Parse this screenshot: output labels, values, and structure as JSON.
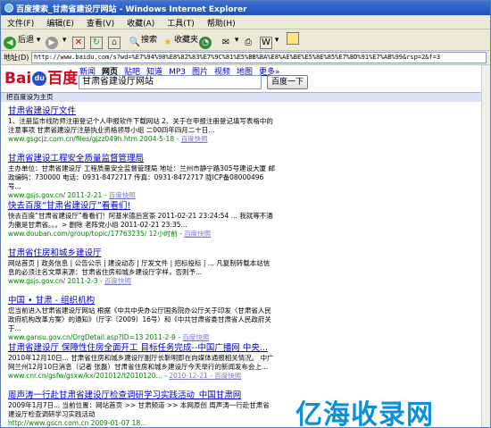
{
  "window": {
    "title": "百度搜索_甘肃省建设厅网站 - Windows Internet Explorer"
  },
  "menu": [
    "文件(F)",
    "编辑(E)",
    "查看(V)",
    "收藏(A)",
    "工具(T)",
    "帮助(H)"
  ],
  "toolbar": {
    "back": "后退",
    "search": "搜索",
    "favorites": "收藏夹"
  },
  "address": {
    "label": "地址(D)",
    "url": "http://www.baidu.com/s?wd=%E7%94%98%E8%82%83%E7%9C%81%E5%BB%BA%E8%AE%BE%E5%8E%85%E7%BD%91%E7%AB%99&rsp=2&f=3"
  },
  "baidu": {
    "logo_left": "Bai",
    "logo_paw": "du",
    "logo_right": "百度",
    "nav": [
      "新闻",
      "网页",
      "贴吧",
      "知道",
      "MP3",
      "图片",
      "视频",
      "地图",
      "更多»"
    ],
    "nav_active": "网页",
    "query": "甘肃省建设厅网站",
    "search_button": "百度一下",
    "set_home": "把百度设为主页"
  },
  "results": [
    {
      "title": "甘肃省建设厅文件",
      "desc": "1、注册监市线防师注册登记个人申报软件下载网站 2、关于在甲报注册登记填写表格中的注意事项 甘肃省建设厅注册执业资格领导小组 二00四年四月二十日...",
      "url": "www.gsgcjz.com.cn/files/gjzz049h.htm 2004-5-18",
      "cache": "百度快照"
    },
    {
      "title": "甘肃省建设工程安全质量监督管理局",
      "desc": "主办单位：甘肃省建设厅 工程质量安全监督管理局 地址：兰州市静宁路305号建设大厦 邮政编码：730000 电话：0931-8472717 传真：0931-8472717 陇ICP备08000496号...",
      "url": "www.gsjs.gov.cn/ 2011-2-21",
      "cache": "百度快照"
    },
    {
      "title": "快去百度“甘肃省建设厅”看看们!",
      "desc": "快去百度“甘肃省建设厅”看看们！阿基米德后宫茶 2011-02-21 23:24:54 ... 我就等不通为撒是甘肃省。。。> 删除 老阵党小组 2011-02-21 23:35...",
      "url": "www.douban.com/group/topic/17763235/ 12小时前",
      "cache": "百度快照"
    },
    {
      "title": "甘肃省住房和城乡建设厅",
      "desc": "网站首页 | 政务信息 | 公告公示 | 建设动态 | 厅发文件 | 招标投标 | ... 凡复制转载本站信息的必须注名文章来源：甘肃省住房和城乡建设厅字样，否则予...",
      "url": "www.gsjs.gov.cn/ 2011-2-3",
      "cache": "百度快照"
    },
    {
      "title": "中国 • 甘肃 - 组织机构",
      "desc": "您当前进入甘肃省建设厅网站 根据《中共中央办公厅国务院办公厅关于印发〈甘肃省人民政府机构改革方案〉的通知》（厅字〔2009〕16号）和《中共甘肃省委甘肃省人民政府关于...",
      "url": "www.gansu.gov.cn/OrgDetail.asp?ID=13 2011-2-9",
      "cache": "百度快照"
    },
    {
      "title": "甘肃省建设厅 保障性住房全面开工 目标任务完成--中国广播网 中央...",
      "desc": "2010年12月10日... 甘肃省住房和城乡建设厅副厅长靳明即在向媒体通报相关情况。 中广网兰州12月10日消息（记者 张磊）甘肃省住房和城乡建设厅今天举行的新闻发布会上...",
      "url": "www.cnr.cn/gsfw/gsxw/kx/201012/t2010120...",
      "cache": "2010-12-21 - 百度快照"
    },
    {
      "title": "周声涛一行赴甘肃省建设厅检查调研学习实践活动_中国甘肃网",
      "desc": "2009年1月7日... 当前位置：网站首页 >> 甘肃频道 >> 本网原创 周声涛一行赴甘肃省建设厅检查调研学习实践活动",
      "url": "http://www.gscn.com.cn 2009-01-07 18...",
      "cache": ""
    }
  ],
  "watermark": "亿海收录网"
}
